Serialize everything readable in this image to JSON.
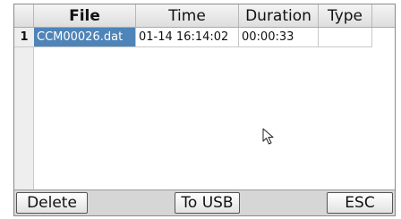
{
  "table": {
    "columns": [
      "File",
      "Time",
      "Duration",
      "Type"
    ],
    "rows": [
      {
        "index": "1",
        "file": "CCM00026.dat",
        "time": "01-14 16:14:02",
        "duration": "00:00:33",
        "type": ""
      }
    ],
    "selected_color": "#4f84b8"
  },
  "buttons": {
    "delete": "Delete",
    "to_usb": "To USB",
    "esc": "ESC"
  }
}
